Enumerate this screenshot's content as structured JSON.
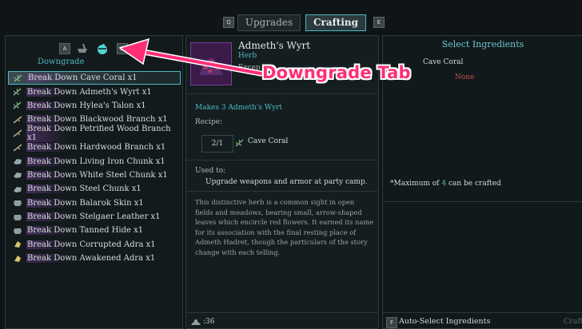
{
  "top_tabs": {
    "left_key": "Q",
    "right_key": "E",
    "upgrades": "Upgrades",
    "crafting": "Crafting"
  },
  "left_panel": {
    "left_key": "A",
    "right_key": "D",
    "category_label": "Downgrade",
    "items": [
      {
        "label": "Break Down Cave Coral x1",
        "icon": "herb-icon",
        "selected": true
      },
      {
        "label": "Break Down Admeth's Wyrt x1",
        "icon": "herb-icon",
        "selected": false
      },
      {
        "label": "Break Down Hylea's Talon x1",
        "icon": "herb-icon",
        "selected": false
      },
      {
        "label": "Break Down Blackwood Branch x1",
        "icon": "branch-icon",
        "selected": false
      },
      {
        "label": "Break Down Petrified Wood Branch x1",
        "icon": "branch-icon",
        "selected": false
      },
      {
        "label": "Break Down Hardwood Branch x1",
        "icon": "branch-icon",
        "selected": false
      },
      {
        "label": "Break Down Living Iron Chunk x1",
        "icon": "chunk-icon",
        "selected": false
      },
      {
        "label": "Break Down White Steel Chunk x1",
        "icon": "chunk-icon",
        "selected": false
      },
      {
        "label": "Break Down Steel Chunk x1",
        "icon": "chunk-icon",
        "selected": false
      },
      {
        "label": "Break Down Balarok Skin x1",
        "icon": "hide-icon",
        "selected": false
      },
      {
        "label": "Break Down Stelgaer Leather x1",
        "icon": "hide-icon",
        "selected": false
      },
      {
        "label": "Break Down Tanned Hide x1",
        "icon": "hide-icon",
        "selected": false
      },
      {
        "label": "Break Down Corrupted Adra x1",
        "icon": "adra-icon",
        "selected": false
      },
      {
        "label": "Break Down Awakened Adra x1",
        "icon": "adra-icon",
        "selected": false
      }
    ]
  },
  "middle_panel": {
    "item_name": "Admeth's Wyrt",
    "item_type": "Herb",
    "item_note": "Excep",
    "makes": "Makes 3 Admeth's Wyrt",
    "recipe_label": "Recipe:",
    "recipe_qty": "2/1",
    "recipe_ingredient": "Cave Coral",
    "used_to_label": "Used to:",
    "used_to_text": "Upgrade weapons and armor at party camp.",
    "description": "This distinctive herb is a common sight in open fields and meadows, bearing small, arrow-shaped leaves which encircle red flowers. It earned its name for its association with the final resting place of Admeth Hadret, though the particulars of the story change with each telling.",
    "currency_value": ":36"
  },
  "right_panel": {
    "title": "Select Ingredients",
    "ingredient_name": "Cave Coral",
    "ingredient_value": "None",
    "max_prefix": "*Maximum of ",
    "max_value": "4",
    "max_suffix": " can be crafted",
    "auto_select_key": "F",
    "auto_select_label": "Auto-Select Ingredients",
    "craft_label": "Craft"
  },
  "annotation": {
    "label": "Downgrade Tab",
    "color": "#ff2e75"
  },
  "colors": {
    "accent": "#4fb8c2",
    "selection_highlight": "#6e3c8c",
    "warning": "#c0524a"
  }
}
